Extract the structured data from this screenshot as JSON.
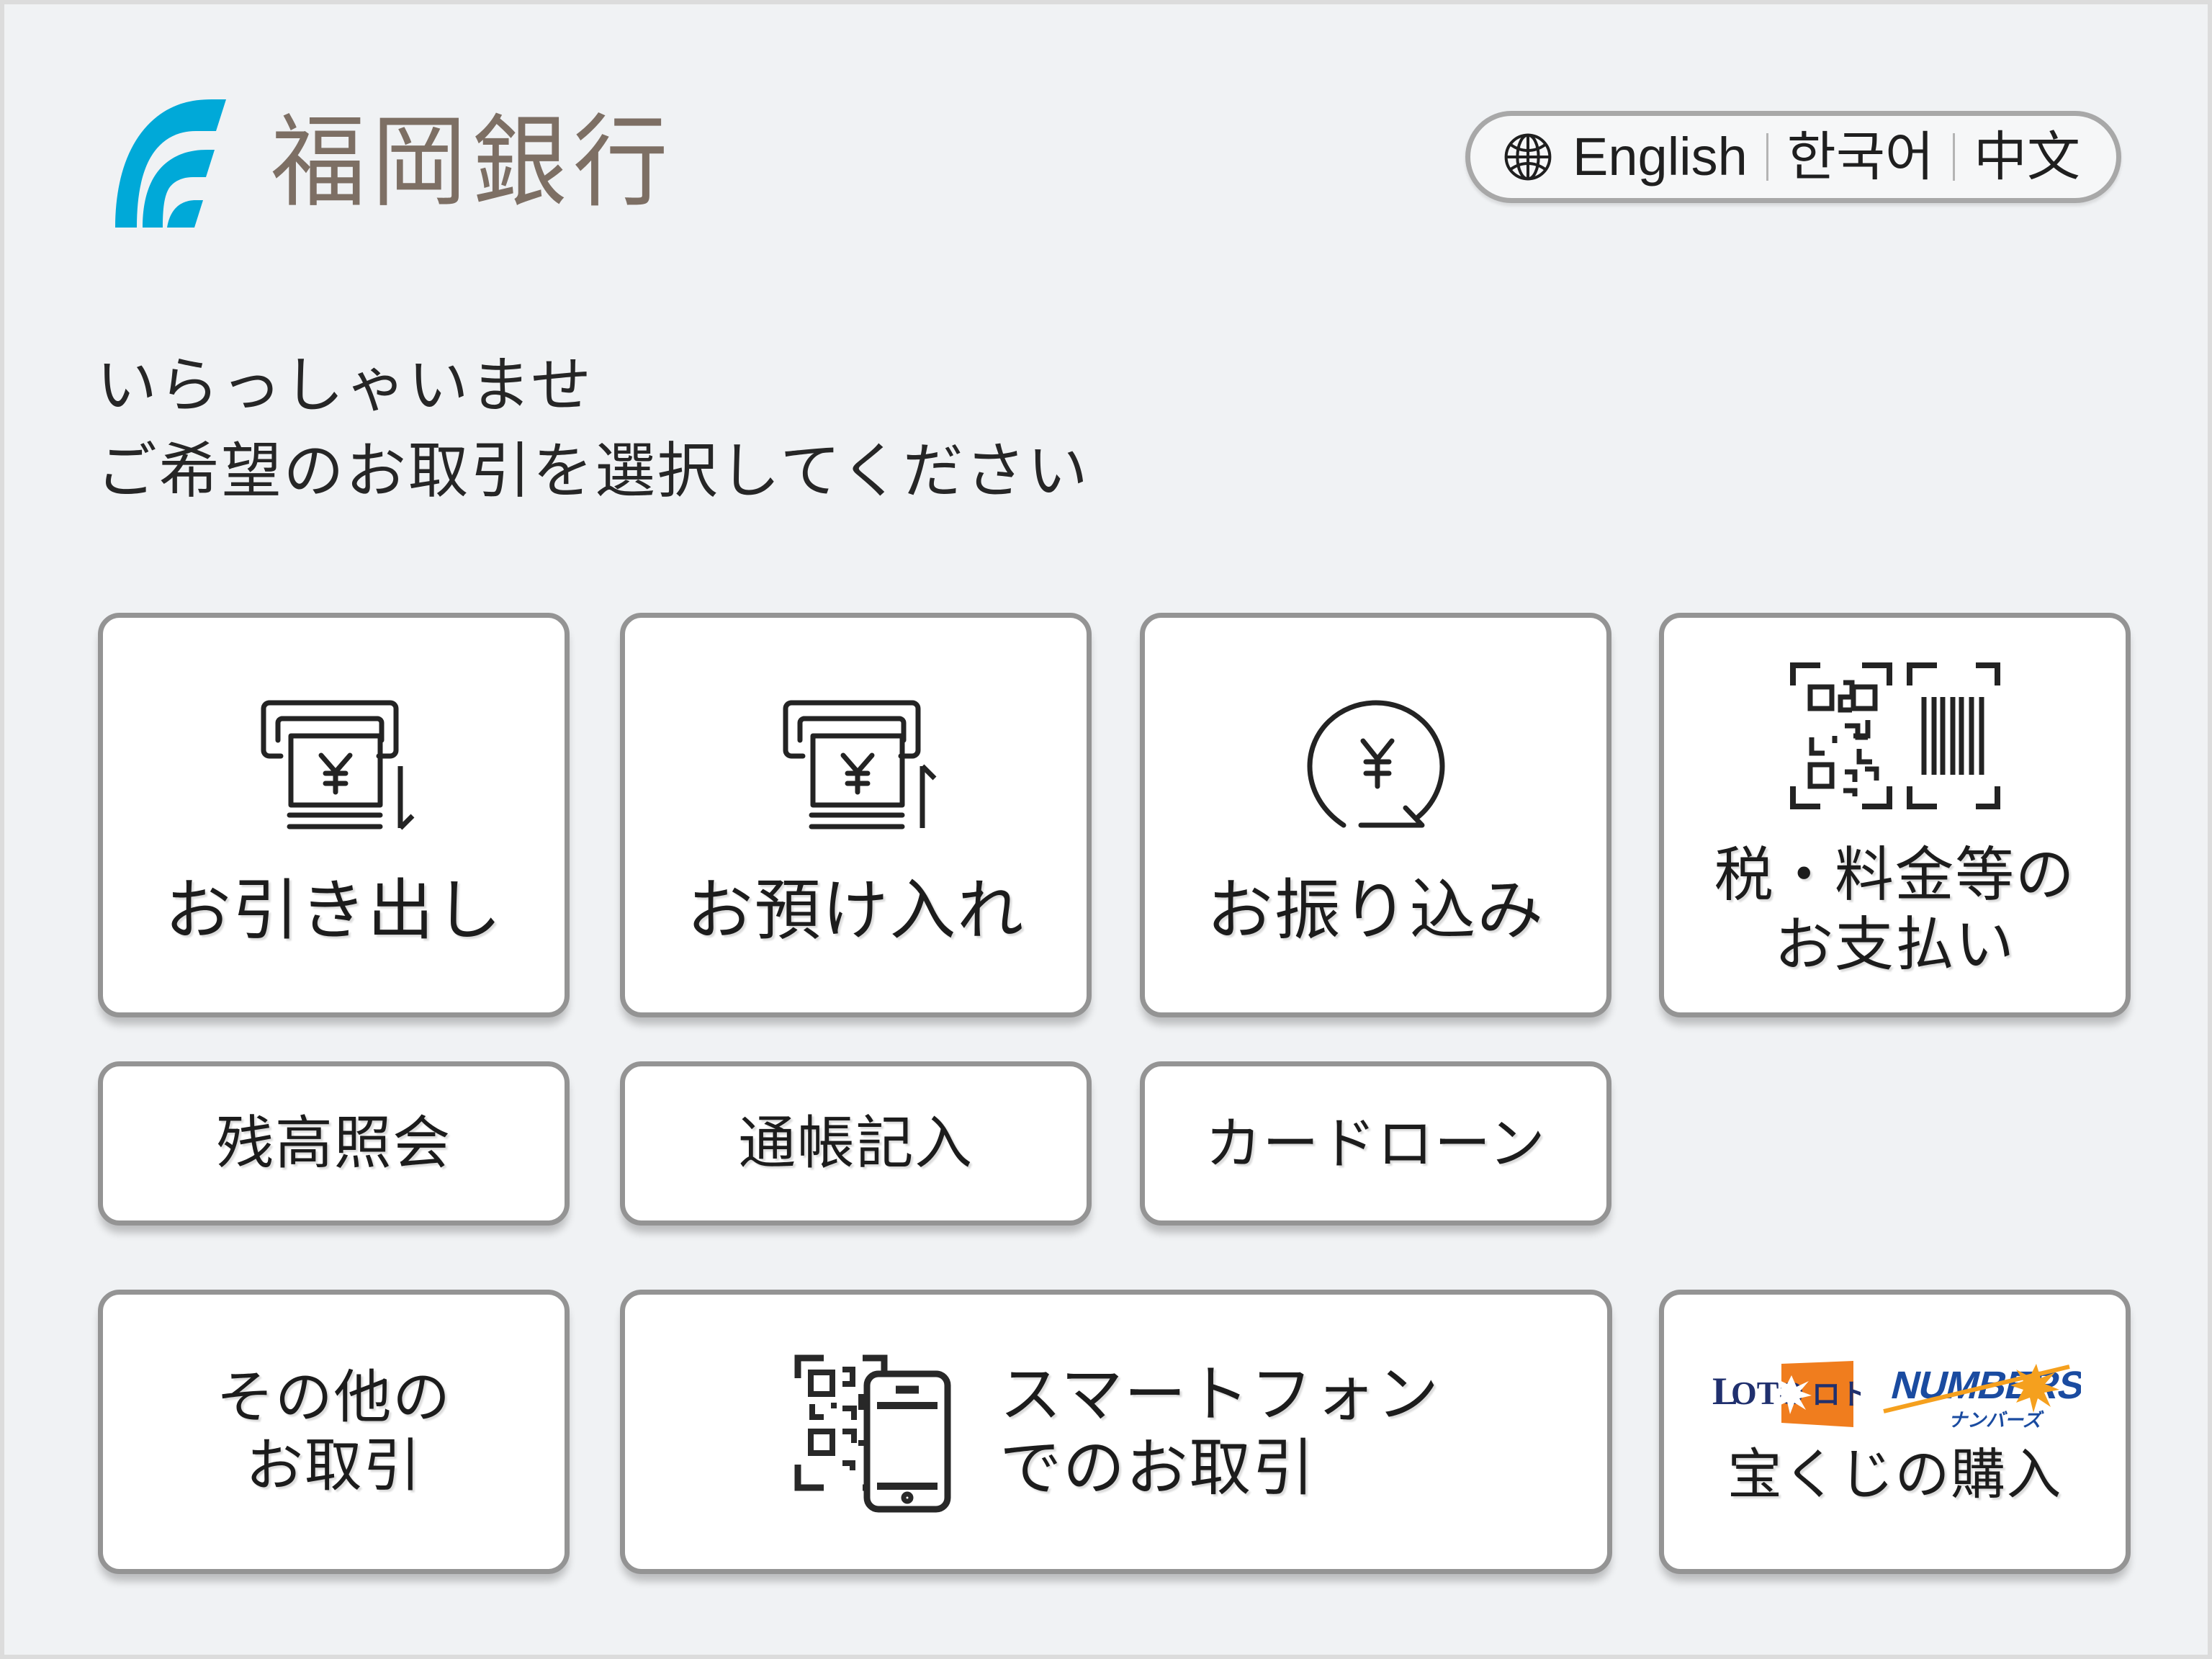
{
  "header": {
    "bank_name": "福岡銀行",
    "logo_color": "#00a9d8",
    "bank_name_color": "#7d6f64",
    "language_selector": {
      "icon": "globe-icon",
      "options": [
        "English",
        "한국어",
        "中文"
      ]
    }
  },
  "greeting": {
    "line1": "いらっしゃいませ",
    "line2": "ご希望のお取引を選択してください"
  },
  "menu": {
    "row1": [
      {
        "id": "withdraw",
        "label": "お引き出し",
        "icon": "atm-cash-out-icon"
      },
      {
        "id": "deposit",
        "label": "お預け入れ",
        "icon": "atm-cash-in-icon"
      },
      {
        "id": "transfer",
        "label": "お振り込み",
        "icon": "yen-transfer-icon"
      },
      {
        "id": "tax",
        "label": "税・料金等の\nお支払い",
        "icon": "qr-barcode-scan-icon"
      }
    ],
    "row2": [
      {
        "id": "balance",
        "label": "残高照会"
      },
      {
        "id": "passbook",
        "label": "通帳記入"
      },
      {
        "id": "cardloan",
        "label": "カードローン"
      }
    ],
    "row3": [
      {
        "id": "other",
        "label": "その他の\nお取引"
      },
      {
        "id": "smartphone",
        "label": "スマートフォン\nでのお取引",
        "icon": "qr-smartphone-icon"
      },
      {
        "id": "lottery",
        "label": "宝くじの購入",
        "logos": [
          {
            "name": "loto-logo",
            "text": "LOTO",
            "sub": "ロト",
            "bg": "#f07d1e",
            "fg": "#1f3a80"
          },
          {
            "name": "numbers-logo",
            "text": "NUMBERS",
            "sub": "ナンバーズ",
            "bg": "#ffffff",
            "fg": "#1a4ba0",
            "accent": "#f5a01e"
          }
        ]
      }
    ]
  },
  "colors": {
    "background": "#f0f2f4",
    "button_bg": "#ffffff",
    "button_border": "#949494",
    "text": "#1c1c1c"
  }
}
